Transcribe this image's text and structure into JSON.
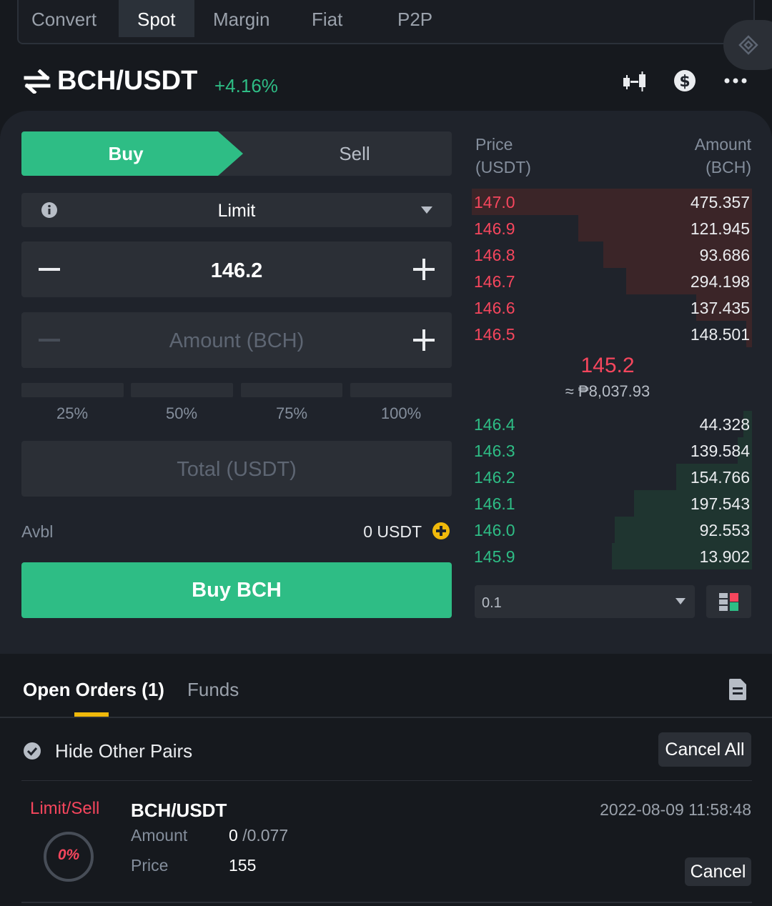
{
  "top_tabs": [
    "Convert",
    "Spot",
    "Margin",
    "Fiat",
    "P2P"
  ],
  "active_tab": "Spot",
  "pair": {
    "name": "BCH/USDT",
    "change": "+4.16%"
  },
  "trade": {
    "buy_label": "Buy",
    "sell_label": "Sell",
    "order_type": "Limit",
    "price_value": "146.2",
    "amount_placeholder": "Amount (BCH)",
    "percentages": [
      "25%",
      "50%",
      "75%",
      "100%"
    ],
    "total_placeholder": "Total (USDT)",
    "avbl_label": "Avbl",
    "avbl_value": "0 USDT",
    "submit_label": "Buy BCH"
  },
  "orderbook": {
    "price_header": "Price",
    "price_unit": "(USDT)",
    "amount_header": "Amount",
    "amount_unit": "(BCH)",
    "asks": [
      {
        "price": "147.0",
        "amount": "475.357",
        "depth": 1.0
      },
      {
        "price": "146.9",
        "amount": "121.945",
        "depth": 0.62
      },
      {
        "price": "146.8",
        "amount": "93.686",
        "depth": 0.53
      },
      {
        "price": "146.7",
        "amount": "294.198",
        "depth": 0.45
      },
      {
        "price": "146.6",
        "amount": "137.435",
        "depth": 0.2
      },
      {
        "price": "146.5",
        "amount": "148.501",
        "depth": 0.02
      }
    ],
    "last_price": "145.2",
    "last_price_fiat": "≈ ₱8,037.93",
    "bids": [
      {
        "price": "146.4",
        "amount": "44.328",
        "depth": 0.03
      },
      {
        "price": "146.3",
        "amount": "139.584",
        "depth": 0.05
      },
      {
        "price": "146.2",
        "amount": "154.766",
        "depth": 0.27
      },
      {
        "price": "146.1",
        "amount": "197.543",
        "depth": 0.42
      },
      {
        "price": "146.0",
        "amount": "92.553",
        "depth": 0.49
      },
      {
        "price": "145.9",
        "amount": "13.902",
        "depth": 0.5
      }
    ],
    "precision": "0.1"
  },
  "orders": {
    "tabs": [
      "Open Orders (1)",
      "Funds"
    ],
    "hide_other_pairs": "Hide Other Pairs",
    "cancel_all": "Cancel All",
    "items": [
      {
        "type": "Limit/Sell",
        "pair": "BCH/USDT",
        "datetime": "2022-08-09 11:58:48",
        "progress": "0%",
        "amount_label": "Amount",
        "amount_filled": "0",
        "amount_total": "/0.077",
        "price_label": "Price",
        "price_value": "155",
        "cancel_label": "Cancel"
      }
    ]
  },
  "colors": {
    "green": "#2ebd85",
    "red": "#f6465d",
    "yellow": "#f0b90b",
    "bg": "#1f232b",
    "panel": "#2b2f36"
  }
}
